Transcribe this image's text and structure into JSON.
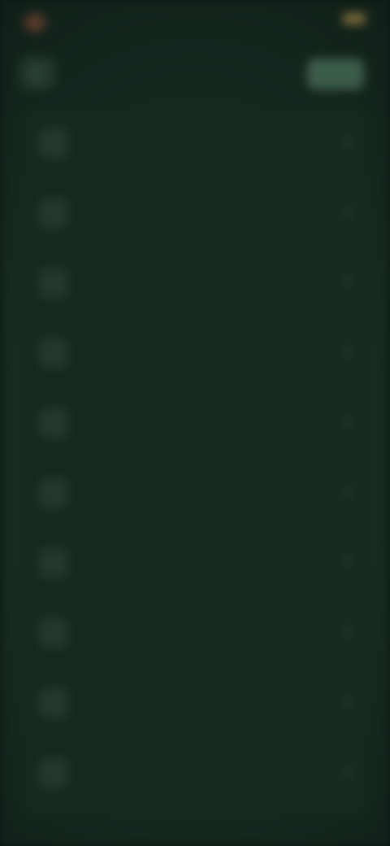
{
  "status_bar": {
    "app_label": "",
    "time": ""
  },
  "header": {
    "title": "",
    "action_label": ""
  },
  "list": {
    "items": [
      {
        "title": "",
        "subtitle": ""
      },
      {
        "title": "",
        "subtitle": ""
      },
      {
        "title": "",
        "subtitle": ""
      },
      {
        "title": "",
        "subtitle": ""
      },
      {
        "title": "",
        "subtitle": ""
      },
      {
        "title": "",
        "subtitle": ""
      },
      {
        "title": "",
        "subtitle": ""
      },
      {
        "title": "",
        "subtitle": ""
      },
      {
        "title": "",
        "subtitle": ""
      },
      {
        "title": "",
        "subtitle": ""
      }
    ]
  },
  "icons": {
    "back": "chevron-left-icon",
    "row_icon": "list-item-icon",
    "row_chevron": "chevron-right-icon",
    "battery": "battery-icon"
  },
  "colors": {
    "background": "#0c1813",
    "card": "#17291f",
    "accent": "#3c5c4a",
    "status_pill": "#5a3a2c",
    "battery": "#7a6a3a"
  }
}
